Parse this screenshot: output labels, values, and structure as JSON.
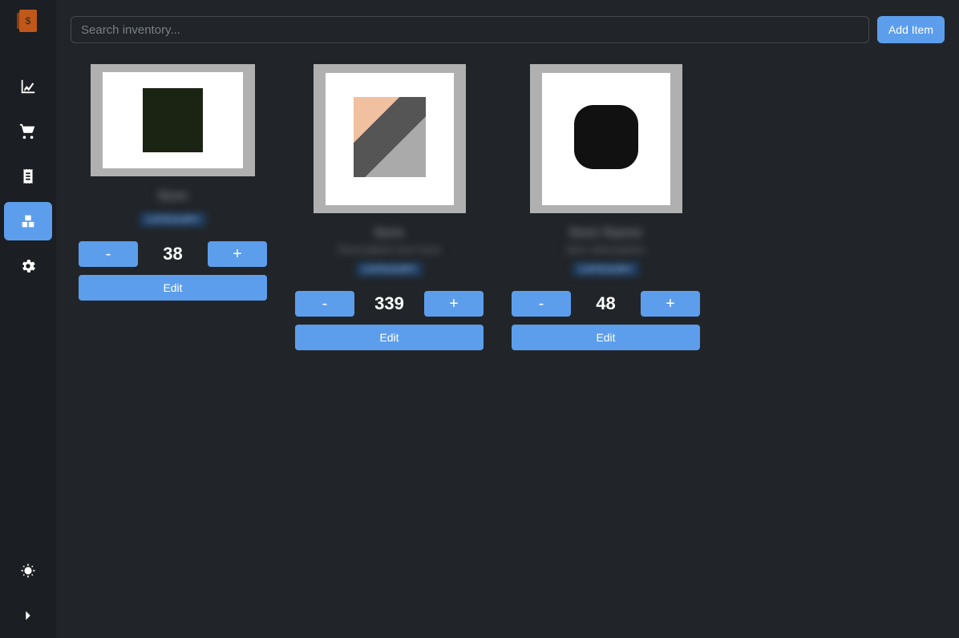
{
  "search": {
    "placeholder": "Search inventory..."
  },
  "buttons": {
    "add_item": "Add Item",
    "minus": "-",
    "plus": "+",
    "edit": "Edit"
  },
  "sidebar": {
    "items": [
      "analytics",
      "cart",
      "receipt",
      "inventory",
      "settings"
    ],
    "active_index": 3
  },
  "items": [
    {
      "title": "Item",
      "sub": "",
      "badge": "CATEGORY",
      "qty": 38
    },
    {
      "title": "Item",
      "sub": "Description text here",
      "badge": "CATEGORY",
      "qty": 339
    },
    {
      "title": "Item Name",
      "sub": "Item description",
      "badge": "CATEGORY",
      "qty": 48
    }
  ]
}
